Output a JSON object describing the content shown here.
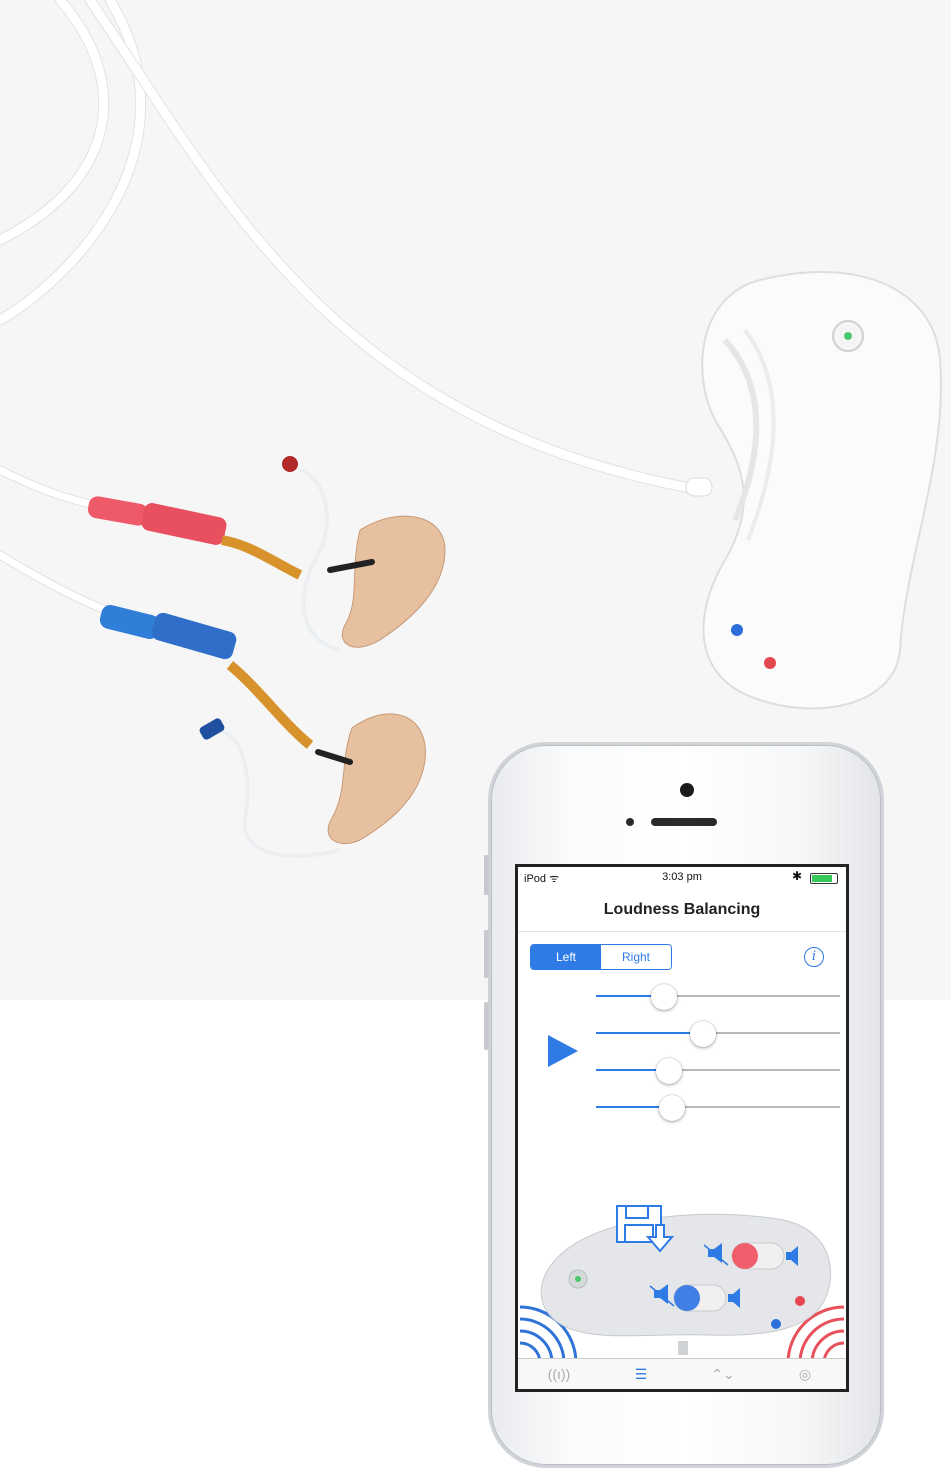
{
  "status_bar": {
    "carrier": "iPod ᯤ",
    "time": "3:03 pm",
    "bluetooth": "✱",
    "battery_level": 0.85
  },
  "nav": {
    "title": "Loudness Balancing"
  },
  "segment": {
    "left_label": "Left",
    "right_label": "Right",
    "selected": "Left"
  },
  "info_icon": "info-icon",
  "info_glyph": "i",
  "play_icon": "play-icon",
  "sliders": [
    {
      "level": 0.28
    },
    {
      "level": 0.44
    },
    {
      "level": 0.3
    },
    {
      "level": 0.31
    }
  ],
  "device_panel": {
    "left_switch_color": "#f05d6b",
    "right_switch_color": "#3f7fe6",
    "mute_icon": "speaker-mute-icon",
    "speaker_icon": "speaker-icon",
    "save_icon": "save-to-device-icon"
  },
  "tabs": [
    {
      "icon": "antenna-icon",
      "glyph": "((ı))"
    },
    {
      "icon": "sliders-icon",
      "glyph": "☰"
    },
    {
      "icon": "chevrons-icon",
      "glyph": "⌃⌄"
    },
    {
      "icon": "lifebuoy-icon",
      "glyph": "◎"
    }
  ],
  "colors": {
    "accent": "#2f7be6",
    "red_channel": "#e8505b",
    "blue_channel": "#2f73d9"
  }
}
